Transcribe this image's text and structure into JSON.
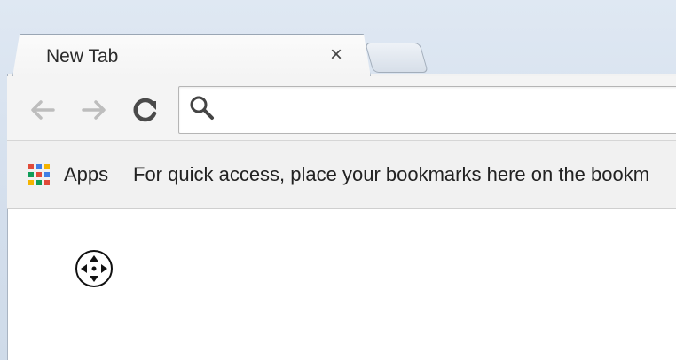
{
  "tab": {
    "title": "New Tab",
    "close_glyph": "×"
  },
  "toolbar": {
    "back_icon": "arrow-left-icon",
    "forward_icon": "arrow-right-icon",
    "reload_icon": "reload-icon",
    "omnibox": {
      "value": "",
      "placeholder": ""
    }
  },
  "bookmarks_bar": {
    "apps_label": "Apps",
    "hint": "For quick access, place your bookmarks here on the bookm"
  },
  "content": {
    "cursor_icon": "pan-cursor-icon"
  },
  "colors": {
    "frame": "#d3deec",
    "toolbar": "#f4f4f4",
    "content": "#ffffff"
  }
}
